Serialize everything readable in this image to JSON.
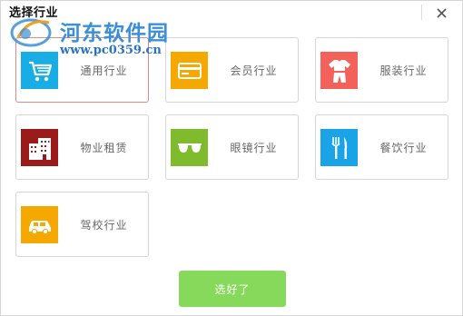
{
  "window": {
    "title": "选择行业"
  },
  "watermark": {
    "site_name": "河东软件园",
    "url": "www.pc0359.cn"
  },
  "industries": [
    {
      "label": "通用行业",
      "icon": "shopping-cart-icon",
      "color": "#18aee5",
      "selected": true
    },
    {
      "label": "会员行业",
      "icon": "member-card-icon",
      "color": "#f5a800",
      "selected": false
    },
    {
      "label": "服装行业",
      "icon": "clothing-icon",
      "color": "#f2625b",
      "selected": false
    },
    {
      "label": "物业租赁",
      "icon": "building-icon",
      "color": "#9b1a1a",
      "selected": false
    },
    {
      "label": "眼镜行业",
      "icon": "glasses-icon",
      "color": "#7fbb2c",
      "selected": false
    },
    {
      "label": "餐饮行业",
      "icon": "fork-knife-icon",
      "color": "#1aa3e6",
      "selected": false
    },
    {
      "label": "驾校行业",
      "icon": "car-icon",
      "color": "#f5a800",
      "selected": false
    }
  ],
  "confirm_button": {
    "label": "选好了",
    "color": "#86d95a"
  }
}
